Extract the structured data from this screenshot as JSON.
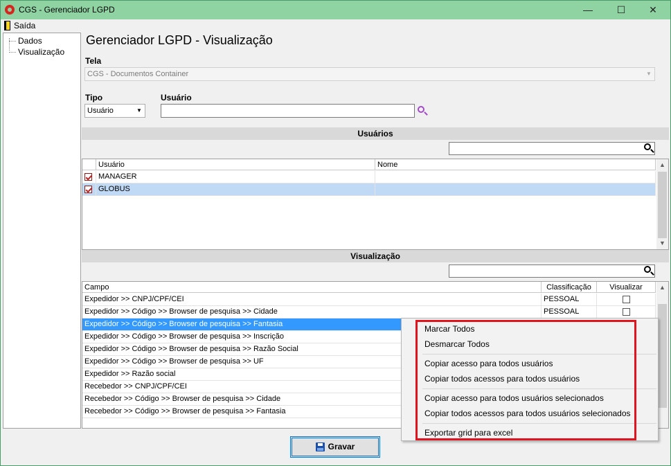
{
  "window": {
    "title": "CGS - Gerenciador LGPD",
    "minimize": "—",
    "maximize": "☐",
    "close": "✕"
  },
  "menu": {
    "exit": "Saída"
  },
  "tree": {
    "items": [
      {
        "label": "Dados"
      },
      {
        "label": "Visualização"
      }
    ]
  },
  "page": {
    "title": "Gerenciador LGPD - Visualização"
  },
  "form": {
    "tela_label": "Tela",
    "tela_value": "CGS - Documentos Container",
    "tipo_label": "Tipo",
    "tipo_value": "Usuário",
    "usuario_label": "Usuário",
    "usuario_value": ""
  },
  "users_section": {
    "title": "Usuários",
    "search_value": "",
    "columns": [
      "Usuário",
      "Nome"
    ],
    "rows": [
      {
        "usuario": "MANAGER",
        "nome": "",
        "checked": true
      },
      {
        "usuario": "GLOBUS",
        "nome": "",
        "checked": true
      }
    ]
  },
  "view_section": {
    "title": "Visualização",
    "search_value": "",
    "columns": [
      "Campo",
      "Classificação",
      "Visualizar"
    ],
    "rows": [
      {
        "campo": "Expedidor >> CNPJ/CPF/CEI",
        "classificacao": "PESSOAL",
        "visualizar": false
      },
      {
        "campo": "Expedidor >> Código >> Browser de pesquisa >> Cidade",
        "classificacao": "PESSOAL",
        "visualizar": false
      },
      {
        "campo": "Expedidor >> Código >> Browser de pesquisa >> Fantasia",
        "classificacao": "",
        "visualizar": false
      },
      {
        "campo": "Expedidor >> Código >> Browser de pesquisa >> Inscrição",
        "classificacao": "",
        "visualizar": false
      },
      {
        "campo": "Expedidor >> Código >> Browser de pesquisa >> Razão Social",
        "classificacao": "",
        "visualizar": false
      },
      {
        "campo": "Expedidor >> Código >> Browser de pesquisa >> UF",
        "classificacao": "",
        "visualizar": false
      },
      {
        "campo": "Expedidor >> Razão social",
        "classificacao": "",
        "visualizar": false
      },
      {
        "campo": "Recebedor >> CNPJ/CPF/CEI",
        "classificacao": "",
        "visualizar": false
      },
      {
        "campo": "Recebedor >> Código >> Browser de pesquisa >> Cidade",
        "classificacao": "",
        "visualizar": false
      },
      {
        "campo": "Recebedor >> Código >> Browser de pesquisa >> Fantasia",
        "classificacao": "",
        "visualizar": false
      }
    ]
  },
  "context_menu": {
    "items": [
      "Marcar Todos",
      "Desmarcar Todos",
      "Copiar acesso para todos usuários",
      "Copiar todos acessos para todos usuários",
      "Copiar acesso para todos usuários selecionados",
      "Copiar todos acessos para todos usuários selecionados",
      "Exportar grid para excel"
    ]
  },
  "footer": {
    "save_label": "Gravar"
  },
  "colors": {
    "titlebar": "#8fd3a3",
    "selection": "#3399ff",
    "highlight_border": "#e0141e"
  }
}
